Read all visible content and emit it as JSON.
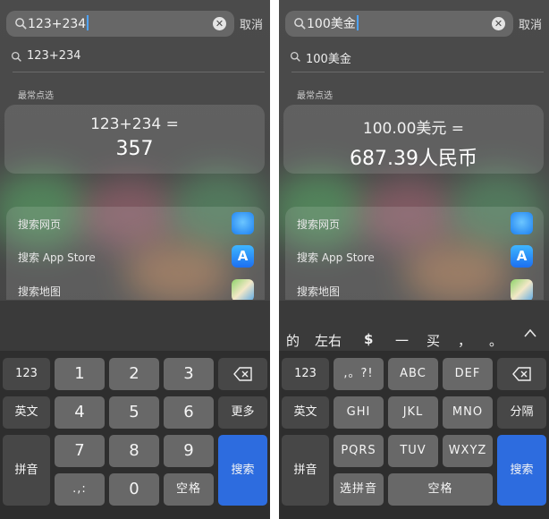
{
  "left": {
    "search_text": "123+234",
    "cancel": "取消",
    "suggestion": "123+234",
    "section_title": "最常点选",
    "calc_expr": "123+234 =",
    "calc_result": "357",
    "actions": [
      "搜索网页",
      "搜索 App Store",
      "搜索地图"
    ],
    "keys": {
      "k123": "123",
      "k1": "1",
      "k2": "2",
      "k3": "3",
      "english": "英文",
      "k4": "4",
      "k5": "5",
      "k6": "6",
      "more": "更多",
      "pinyin": "拼音",
      "k7": "7",
      "k8": "8",
      "k9": "9",
      "punct": ".,:",
      "k0": "0",
      "space": "空格",
      "search": "搜索"
    }
  },
  "right": {
    "search_text": "100美金",
    "cancel": "取消",
    "suggestion": "100美金",
    "section_title": "最常点选",
    "calc_expr": "100.00美元 =",
    "calc_result": "687.39人民币",
    "actions": [
      "搜索网页",
      "搜索 App Store",
      "搜索地图"
    ],
    "candidates": [
      "的",
      "左右",
      "$",
      "一",
      "买",
      "，",
      "。"
    ],
    "keys": {
      "k123": "123",
      "punct": ",。?!",
      "abc": "ABC",
      "def": "DEF",
      "english": "英文",
      "ghi": "GHI",
      "jkl": "JKL",
      "mno": "MNO",
      "emoji": "分隔",
      "pinyin": "拼音",
      "pqrs": "PQRS",
      "tuv": "TUV",
      "wxyz": "WXYZ",
      "select_pinyin": "选拼音",
      "space": "空格",
      "search": "搜索"
    }
  },
  "colors": {
    "search_key": "#2d6cdf",
    "caret": "#4da3ff"
  },
  "icons": [
    "search-icon",
    "clear-icon",
    "safari-icon",
    "app-store-icon",
    "maps-icon",
    "backspace-icon",
    "chevron-up-icon"
  ]
}
